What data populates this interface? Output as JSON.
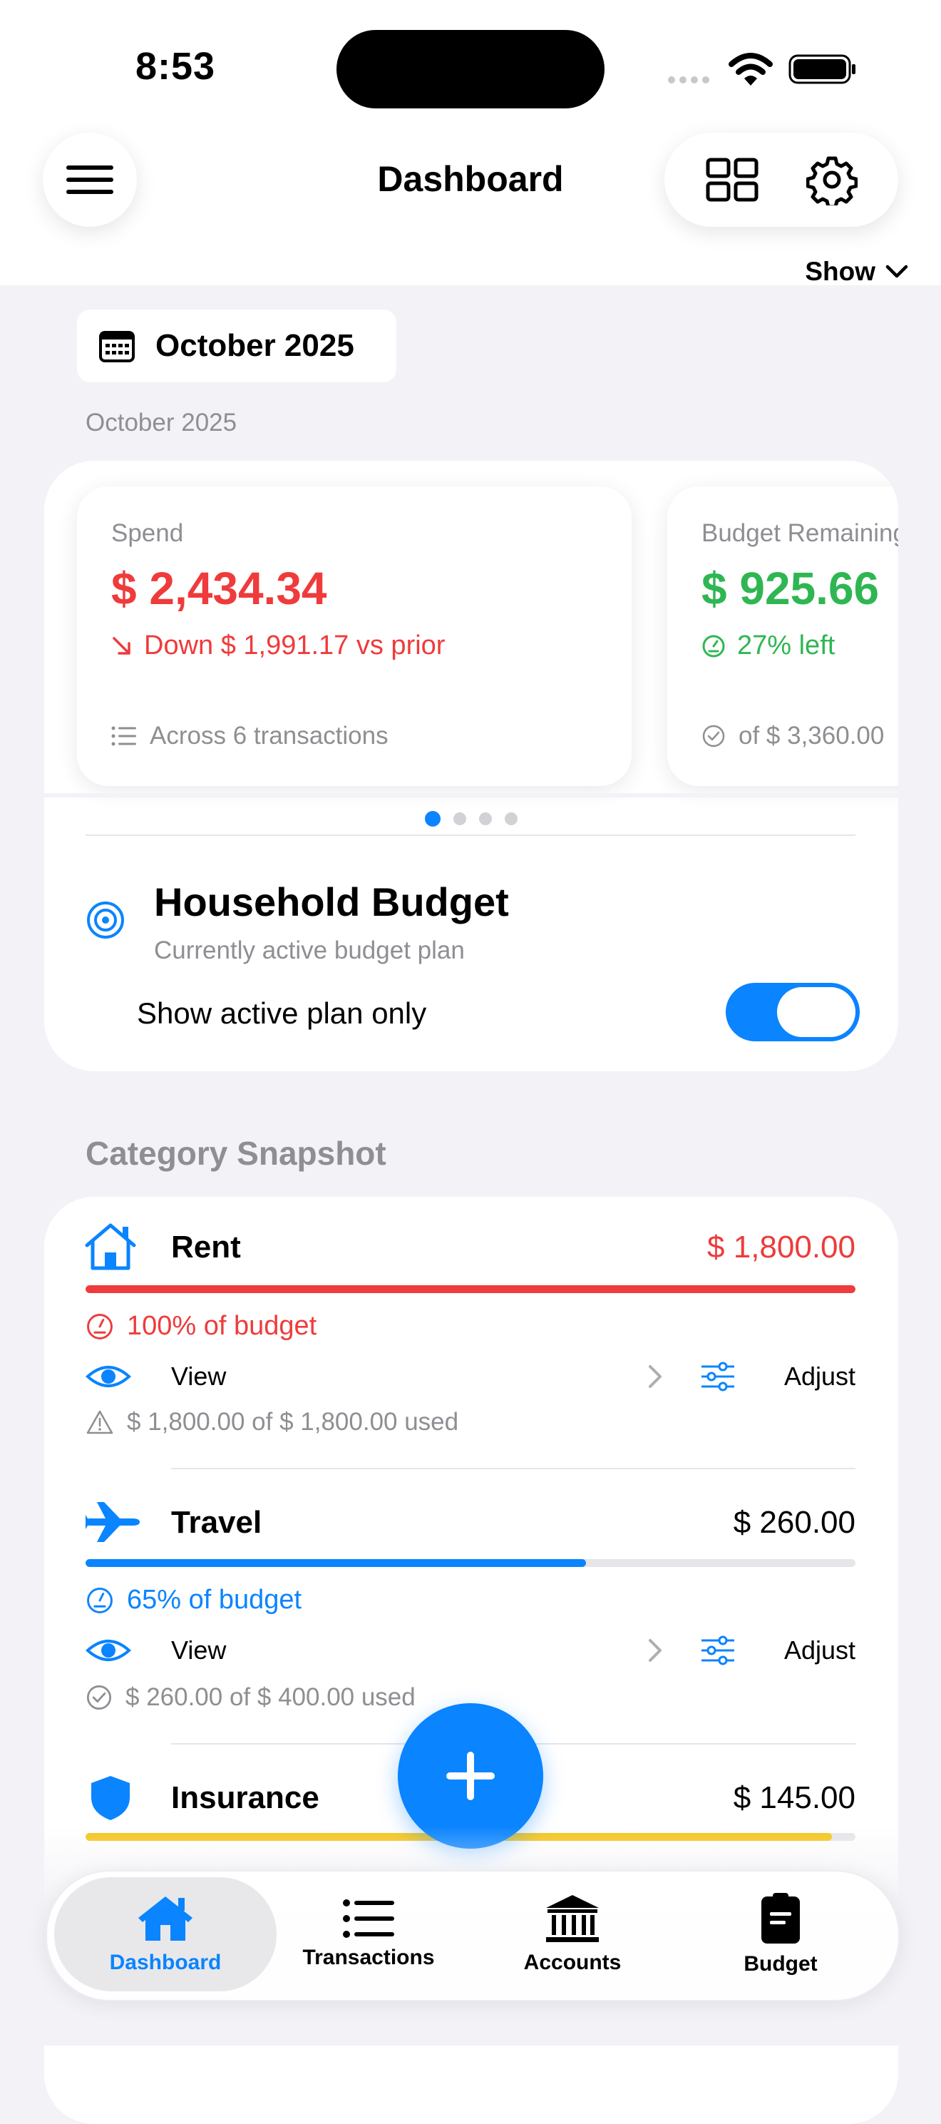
{
  "status_bar": {
    "time": "8:53"
  },
  "header": {
    "title": "Dashboard",
    "show_label": "Show"
  },
  "period": {
    "chip_label": "October 2025",
    "subtitle": "October 2025"
  },
  "metrics": [
    {
      "label": "Spend",
      "value": "$ 2,434.34",
      "delta": "Down $ 1,991.17 vs prior",
      "footer": "Across 6 transactions",
      "value_color": "#ef3b3b"
    },
    {
      "label": "Budget Remaining",
      "value": "$ 925.66",
      "delta": "27% left",
      "footer": "of $ 3,360.00",
      "value_color": "#2fb652"
    }
  ],
  "pager": {
    "count": 4,
    "active": 0
  },
  "plan": {
    "title": "Household Budget",
    "subtitle": "Currently active budget plan",
    "toggle_label": "Show active plan only",
    "toggle_on": true
  },
  "category_section": {
    "title": "Category Snapshot",
    "view_label": "View",
    "adjust_label": "Adjust",
    "items": [
      {
        "name": "Rent",
        "amount": "$ 1,800.00",
        "percent_label": "100% of budget",
        "used": "$ 1,800.00 of $ 1,800.00 used",
        "progress": 1.0,
        "color": "#ef3b3b"
      },
      {
        "name": "Travel",
        "amount": "$ 260.00",
        "percent_label": "65% of budget",
        "used": "$ 260.00 of $ 400.00 used",
        "progress": 0.65,
        "color": "#0a84ff"
      },
      {
        "name": "Insurance",
        "amount": "$ 145.00",
        "percent_label": "",
        "used": "",
        "progress": 0.969,
        "color": "#f5c518"
      }
    ]
  },
  "tabs": [
    {
      "label": "Dashboard",
      "active": true
    },
    {
      "label": "Transactions",
      "active": false
    },
    {
      "label": "Accounts",
      "active": false
    },
    {
      "label": "Budget",
      "active": false
    }
  ],
  "colors": {
    "accent": "#0a84ff",
    "danger": "#ef3b3b",
    "success": "#2fb652",
    "warning": "#f5c518"
  }
}
